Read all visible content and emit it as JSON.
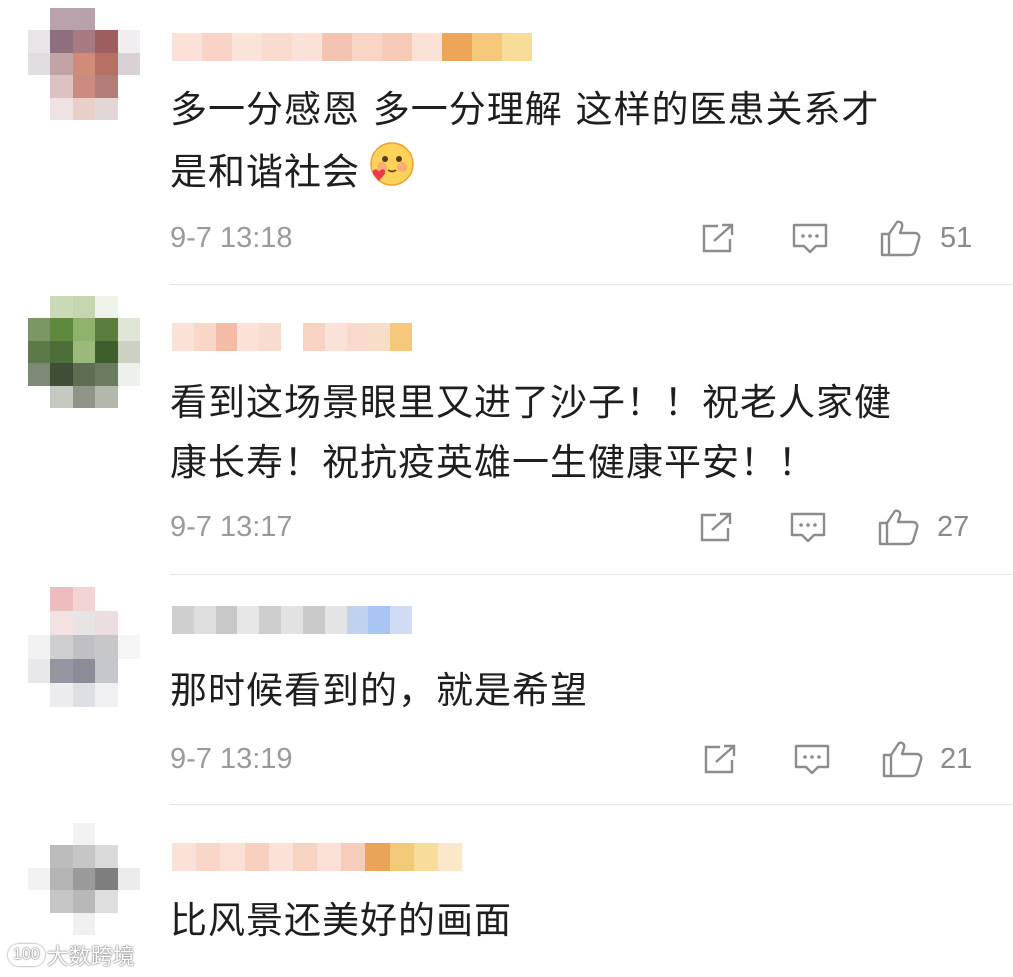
{
  "comments": [
    {
      "text_line1": "多一分感恩 多一分理解 这样的医患关系才",
      "text_line2": "是和谐社会",
      "emoji": "blush-heart-emoji",
      "time": "9-7 13:18",
      "likes": "51"
    },
    {
      "text_line1": "看到这场景眼里又进了沙子！！祝老人家健",
      "text_line2": "康长寿！祝抗疫英雄一生健康平安！！",
      "time": "9-7 13:17",
      "likes": "27"
    },
    {
      "text_line1": "那时候看到的，就是希望",
      "time": "9-7 13:19",
      "likes": "21"
    },
    {
      "text_line1": "比风景还美好的画面"
    }
  ],
  "icons": {
    "repost": "share-icon",
    "comment": "comment-icon",
    "like": "thumbs-up-icon"
  },
  "watermark": {
    "logo_text": "100",
    "text": "大数跨境"
  },
  "colors": {
    "meta_text": "#9a9a9a",
    "icon_stroke": "#8c8c8c",
    "divider": "#e6e6e6"
  }
}
